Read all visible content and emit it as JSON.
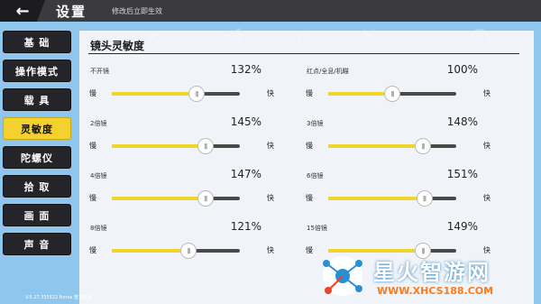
{
  "topbar": {
    "back_icon": "back-arrow-icon",
    "title": "设置",
    "subtitle": "修改后立即生效"
  },
  "sidebar": {
    "items": [
      {
        "label": "基 础",
        "active": false
      },
      {
        "label": "操作模式",
        "active": false
      },
      {
        "label": "载 具",
        "active": false
      },
      {
        "label": "灵敏度",
        "active": true
      },
      {
        "label": "陀螺仪",
        "active": false
      },
      {
        "label": "拾 取",
        "active": false
      },
      {
        "label": "画 面",
        "active": false
      },
      {
        "label": "声 音",
        "active": false
      }
    ]
  },
  "panel": {
    "title": "镜头灵敏度",
    "slow_label": "慢",
    "fast_label": "快",
    "thumb_icon": "grip-icon",
    "items": [
      {
        "label": "不开镜",
        "value": "132%",
        "level": 0.66
      },
      {
        "label": "红点/全息/机瞄",
        "value": "100%",
        "level": 0.5
      },
      {
        "label": "2倍镜",
        "value": "145%",
        "level": 0.73
      },
      {
        "label": "3倍镜",
        "value": "148%",
        "level": 0.74
      },
      {
        "label": "4倍镜",
        "value": "147%",
        "level": 0.73
      },
      {
        "label": "6倍镜",
        "value": "151%",
        "level": 0.75
      },
      {
        "label": "8倍镜",
        "value": "121%",
        "level": 0.6
      },
      {
        "label": "15倍镜",
        "value": "149%",
        "level": 0.74
      }
    ]
  },
  "footer": {
    "version": "V.5.27.335522 Norse 奋力体验"
  },
  "watermark": {
    "title": "星火智游网",
    "url": "WWW.XHCS188.COM"
  },
  "colors": {
    "accent": "#f3d230",
    "sidebar_bg": "#24242a",
    "topbar_bg": "#3b3b3f",
    "background": "#8ec6ee"
  }
}
